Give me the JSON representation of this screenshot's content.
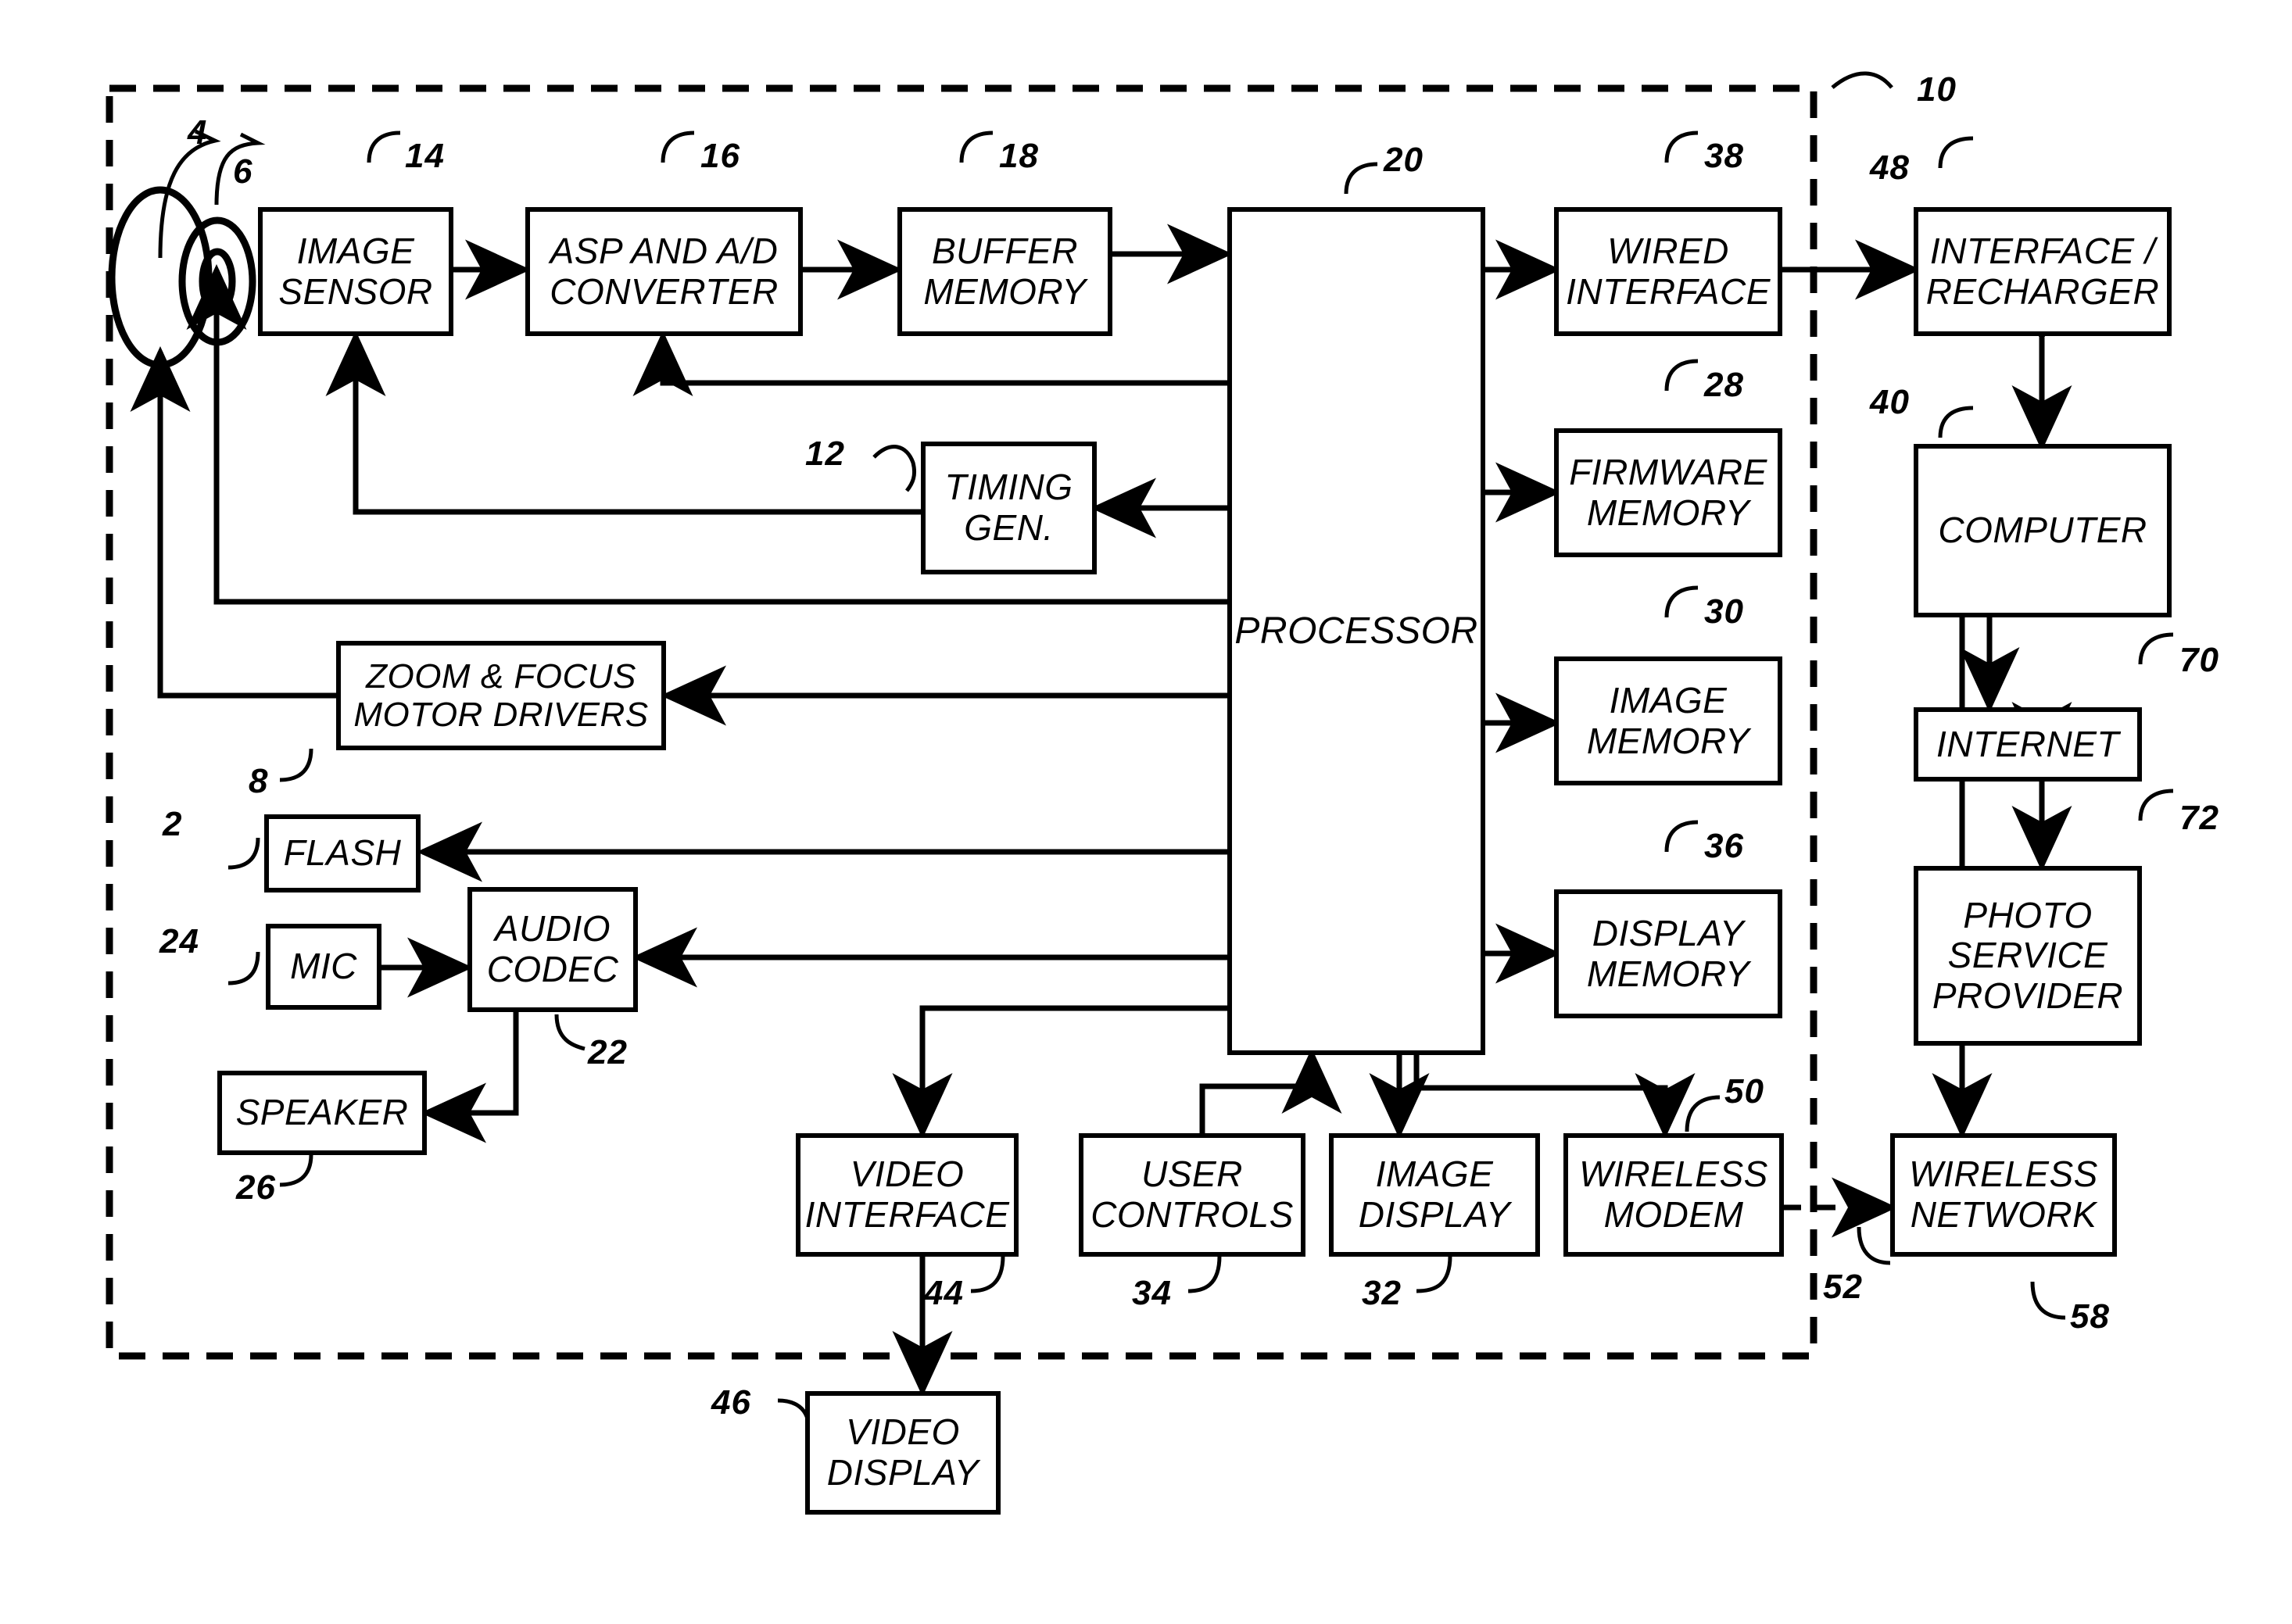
{
  "figure": {
    "type": "patent-block-diagram",
    "description": "Digital camera system block diagram"
  },
  "blocks": [
    {
      "id": "image_sensor",
      "label": "IMAGE\nSENSOR",
      "ref": "14"
    },
    {
      "id": "asp_ad",
      "label": "ASP AND A/D\nCONVERTER",
      "ref": "16"
    },
    {
      "id": "buffer_memory",
      "label": "BUFFER\nMEMORY",
      "ref": "18"
    },
    {
      "id": "processor",
      "label": "PROCESSOR",
      "ref": "20"
    },
    {
      "id": "wired_interface",
      "label": "WIRED\nINTERFACE",
      "ref": "38"
    },
    {
      "id": "interface_recharger",
      "label": "INTERFACE /\nRECHARGER",
      "ref": "48"
    },
    {
      "id": "timing_gen",
      "label": "TIMING\nGEN.",
      "ref": "12"
    },
    {
      "id": "firmware_memory",
      "label": "FIRMWARE\nMEMORY",
      "ref": "28"
    },
    {
      "id": "computer",
      "label": "COMPUTER",
      "ref": "40"
    },
    {
      "id": "zoom_focus",
      "label": "ZOOM & FOCUS\nMOTOR DRIVERS",
      "ref": "8"
    },
    {
      "id": "image_memory",
      "label": "IMAGE\nMEMORY",
      "ref": "30"
    },
    {
      "id": "internet",
      "label": "INTERNET",
      "ref": "70"
    },
    {
      "id": "flash",
      "label": "FLASH",
      "ref": "2"
    },
    {
      "id": "display_memory",
      "label": "DISPLAY\nMEMORY",
      "ref": "36"
    },
    {
      "id": "photo_service",
      "label": "PHOTO\nSERVICE\nPROVIDER",
      "ref": "72"
    },
    {
      "id": "mic",
      "label": "MIC",
      "ref": "24"
    },
    {
      "id": "audio_codec",
      "label": "AUDIO\nCODEC",
      "ref": "22"
    },
    {
      "id": "speaker",
      "label": "SPEAKER",
      "ref": "26"
    },
    {
      "id": "video_interface",
      "label": "VIDEO\nINTERFACE",
      "ref": "44"
    },
    {
      "id": "user_controls",
      "label": "USER\nCONTROLS",
      "ref": "34"
    },
    {
      "id": "image_display",
      "label": "IMAGE\nDISPLAY",
      "ref": "32"
    },
    {
      "id": "wireless_modem",
      "label": "WIRELESS\nMODEM",
      "ref": "50"
    },
    {
      "id": "wireless_network",
      "label": "WIRELESS\nNETWORK",
      "ref": "58"
    },
    {
      "id": "video_display",
      "label": "VIDEO\nDISPLAY",
      "ref": "46"
    }
  ],
  "labels": {
    "image_sensor_l1": "IMAGE",
    "image_sensor_l2": "SENSOR",
    "asp_l1": "ASP AND A/D",
    "asp_l2": "CONVERTER",
    "buffer_l1": "BUFFER",
    "buffer_l2": "MEMORY",
    "processor": "PROCESSOR",
    "wired_l1": "WIRED",
    "wired_l2": "INTERFACE",
    "irech_l1": "INTERFACE /",
    "irech_l2": "RECHARGER",
    "timing_l1": "TIMING",
    "timing_l2": "GEN.",
    "firm_l1": "FIRMWARE",
    "firm_l2": "MEMORY",
    "computer": "COMPUTER",
    "zoom_l1": "ZOOM & FOCUS",
    "zoom_l2": "MOTOR DRIVERS",
    "imem_l1": "IMAGE",
    "imem_l2": "MEMORY",
    "internet": "INTERNET",
    "flash": "FLASH",
    "dmem_l1": "DISPLAY",
    "dmem_l2": "MEMORY",
    "psp_l1": "PHOTO",
    "psp_l2": "SERVICE",
    "psp_l3": "PROVIDER",
    "mic": "MIC",
    "audio_l1": "AUDIO",
    "audio_l2": "CODEC",
    "speaker": "SPEAKER",
    "vint_l1": "VIDEO",
    "vint_l2": "INTERFACE",
    "uctl_l1": "USER",
    "uctl_l2": "CONTROLS",
    "idisp_l1": "IMAGE",
    "idisp_l2": "DISPLAY",
    "wmodem_l1": "WIRELESS",
    "wmodem_l2": "MODEM",
    "wnet_l1": "WIRELESS",
    "wnet_l2": "NETWORK",
    "vdisp_l1": "VIDEO",
    "vdisp_l2": "DISPLAY"
  },
  "reference_numerals": {
    "camera_enclosure": "10",
    "lens_front": "4",
    "lens_rear": "6",
    "zoom_focus": "8",
    "timing_gen": "12",
    "image_sensor": "14",
    "asp_ad": "16",
    "buffer_memory": "18",
    "processor": "20",
    "audio_codec": "22",
    "mic": "24",
    "speaker": "26",
    "firmware_memory": "28",
    "image_memory": "30",
    "image_display": "32",
    "user_controls": "34",
    "display_memory": "36",
    "wired_interface": "38",
    "computer": "40",
    "video_interface": "44",
    "video_display": "46",
    "interface_recharger": "48",
    "wireless_modem": "50",
    "wireless_link": "52",
    "wireless_network": "58",
    "internet": "70",
    "photo_service_provider": "72",
    "flash": "2"
  },
  "colors": {
    "line": "#000000",
    "background": "#ffffff"
  }
}
